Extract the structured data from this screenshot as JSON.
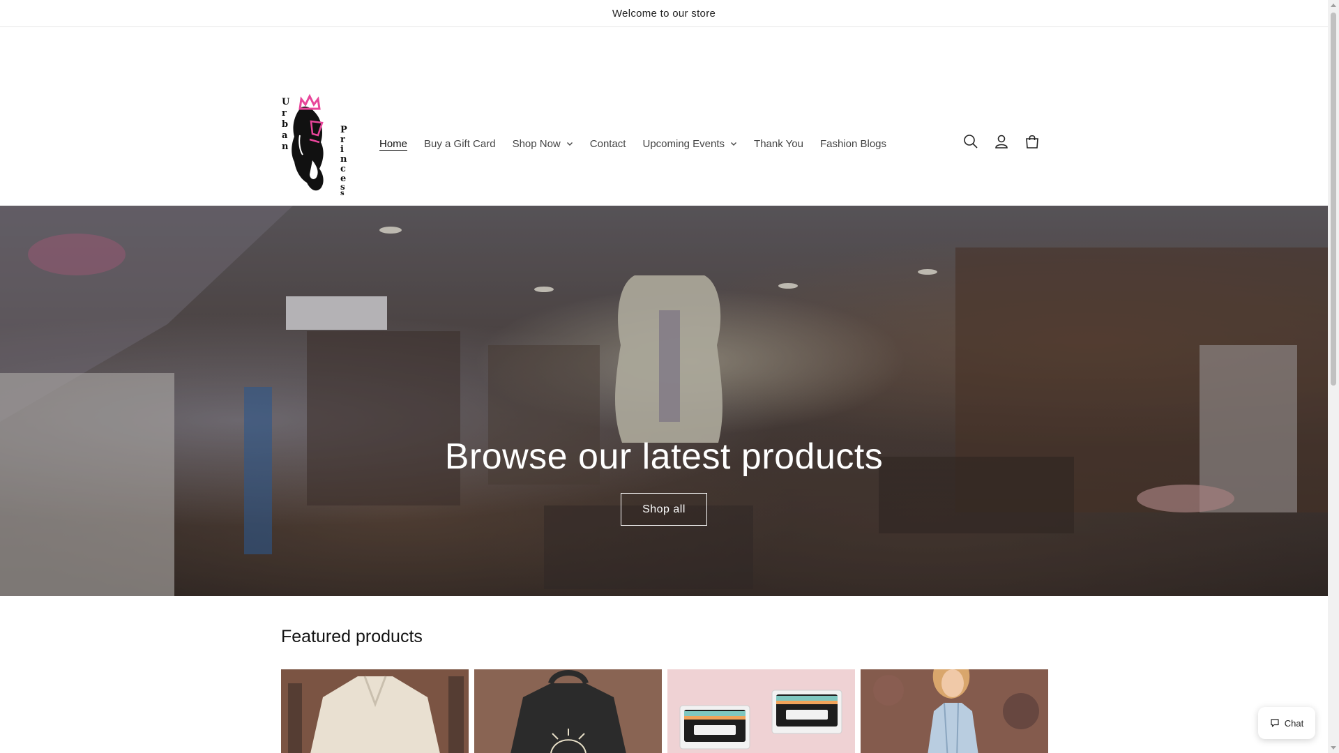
{
  "announcement": {
    "text": "Welcome to our store"
  },
  "header": {
    "logo_text": "Urban Princess",
    "nav": [
      {
        "label": "Home",
        "active": true,
        "dropdown": false
      },
      {
        "label": "Buy a Gift Card",
        "active": false,
        "dropdown": false
      },
      {
        "label": "Shop Now",
        "active": false,
        "dropdown": true
      },
      {
        "label": "Contact",
        "active": false,
        "dropdown": false
      },
      {
        "label": "Upcoming Events",
        "active": false,
        "dropdown": true
      },
      {
        "label": "Thank You",
        "active": false,
        "dropdown": false
      },
      {
        "label": "Fashion Blogs",
        "active": false,
        "dropdown": false
      }
    ],
    "icons": [
      "search-icon",
      "account-icon",
      "cart-icon"
    ]
  },
  "hero": {
    "title": "Browse our latest products",
    "button_label": "Shop all"
  },
  "featured": {
    "title": "Featured products",
    "products": [
      {
        "image": "cream-shirt-photo"
      },
      {
        "image": "black-hoodie-photo"
      },
      {
        "image": "cassette-pins-photo"
      },
      {
        "image": "model-tank-top-photo"
      }
    ]
  },
  "chat": {
    "label": "Chat"
  },
  "colors": {
    "text": "#121212",
    "nav_text": "#444444",
    "accent_pink": "#e8459a"
  }
}
